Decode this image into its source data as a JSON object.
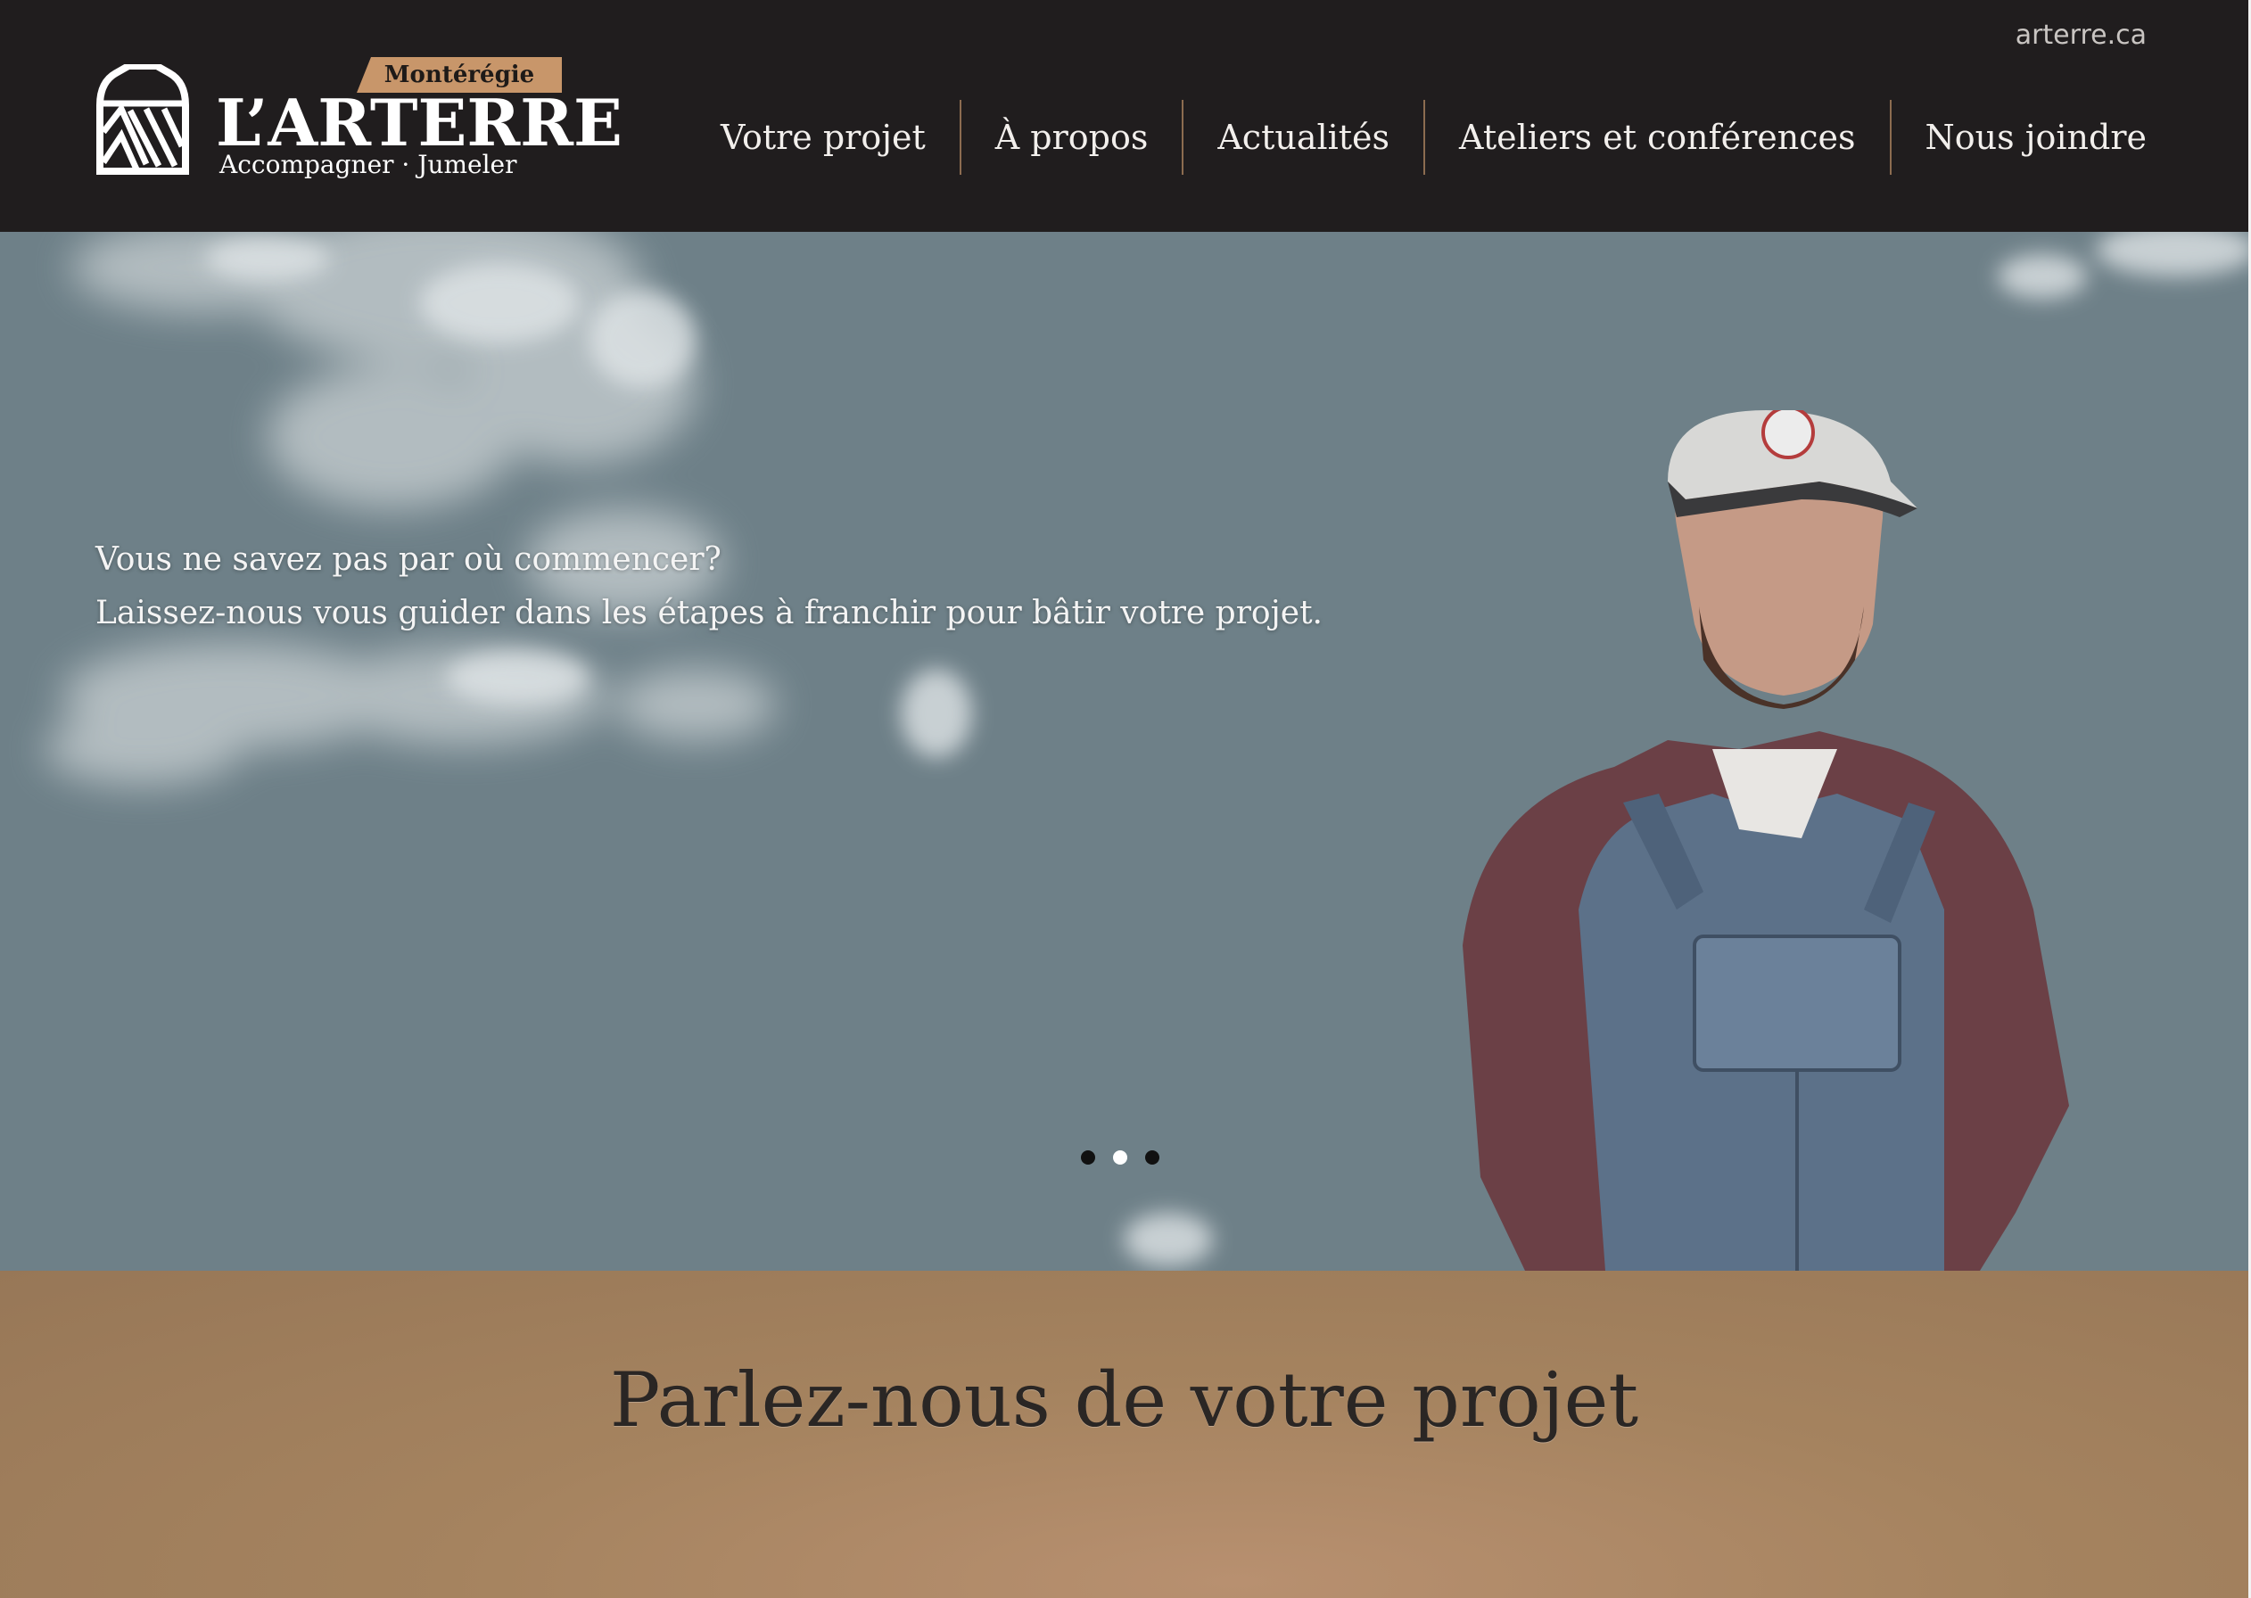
{
  "header": {
    "top_link": "arterre.ca",
    "logo": {
      "region": "Montérégie",
      "name": "L’ARTERRE",
      "tagline": "Accompagner · Jumeler"
    },
    "nav": [
      {
        "label": "Votre projet"
      },
      {
        "label": "À propos"
      },
      {
        "label": "Actualités"
      },
      {
        "label": "Ateliers et conférences"
      },
      {
        "label": "Nous joindre"
      }
    ]
  },
  "hero": {
    "line1": "Vous ne savez pas par où commencer?",
    "line2": "Laissez-nous vous guider dans les étapes à franchir pour bâtir votre projet.",
    "slides_total": 3,
    "active_slide": 2
  },
  "cta": {
    "title": "Parlez-nous de votre projet"
  },
  "colors": {
    "header_bg": "#201d1e",
    "accent": "#c8966a",
    "hero_sky": "#6e8088",
    "cta_bg": "#a5835f"
  }
}
